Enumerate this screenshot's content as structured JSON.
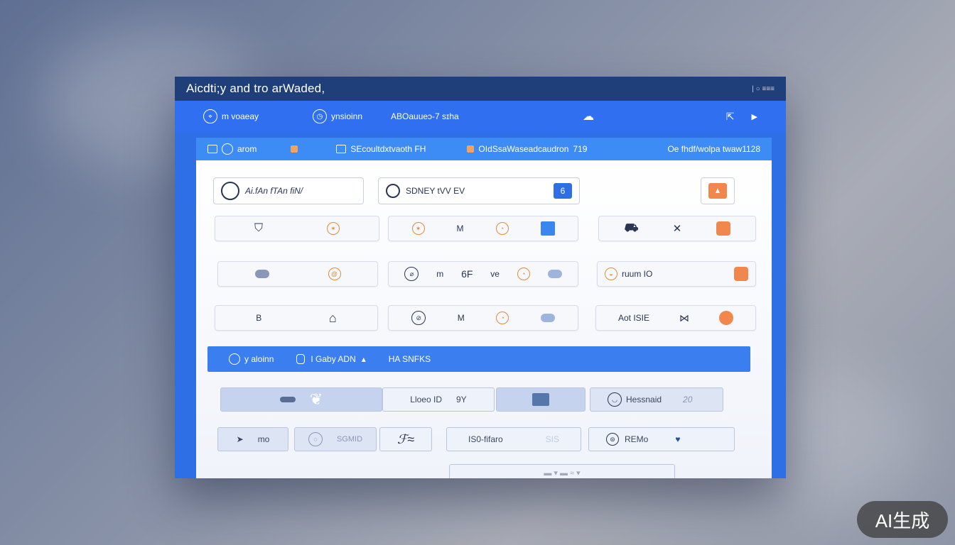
{
  "window": {
    "title": "Aicdti;y and tro arWaded,",
    "controls": "| ○ ≡≡≡"
  },
  "toolbar": {
    "item1": "m voaeay",
    "item2": "ynsioinn",
    "item3": "ABOauueɔ-7 sɪha",
    "right_label": "⇱"
  },
  "tabs": {
    "t1": "arom",
    "t2": "SEcoultdxtvaoth FH",
    "t3": "OIdSsaWaseadcaudron",
    "t3_extra": "719",
    "t4": "Oe fhdf/wolpa twaw1128"
  },
  "fields": {
    "f1": "Ai.fAn fTAn fiN/",
    "f2": "SDNEY tVV EV",
    "f2_btn": "6"
  },
  "grid": {
    "r1c2": "M",
    "r2c2a": "m",
    "r2c2b": "6F",
    "r2c2c": "ve",
    "r2c3": "ruum IO",
    "r3c1": "B",
    "r3c2": "M",
    "r3c3": "Aot ISIE"
  },
  "banner": {
    "b1": "y aloinn",
    "b2": "I Gaby ADN",
    "b3": "HA SNFKS"
  },
  "lower": {
    "l1": "Lloeo ID",
    "l1b": "9Y",
    "l2": "Hessnaid",
    "l2b": "20",
    "m1": "mo",
    "m2": "SGMID",
    "m3": "IS0-fifaro",
    "m3b": "SIS",
    "m4": "REMo"
  },
  "badge": "AI生成",
  "colors": {
    "primary": "#2f6fe6",
    "titlebar": "#1f3f7a",
    "accent": "#f2874d"
  }
}
